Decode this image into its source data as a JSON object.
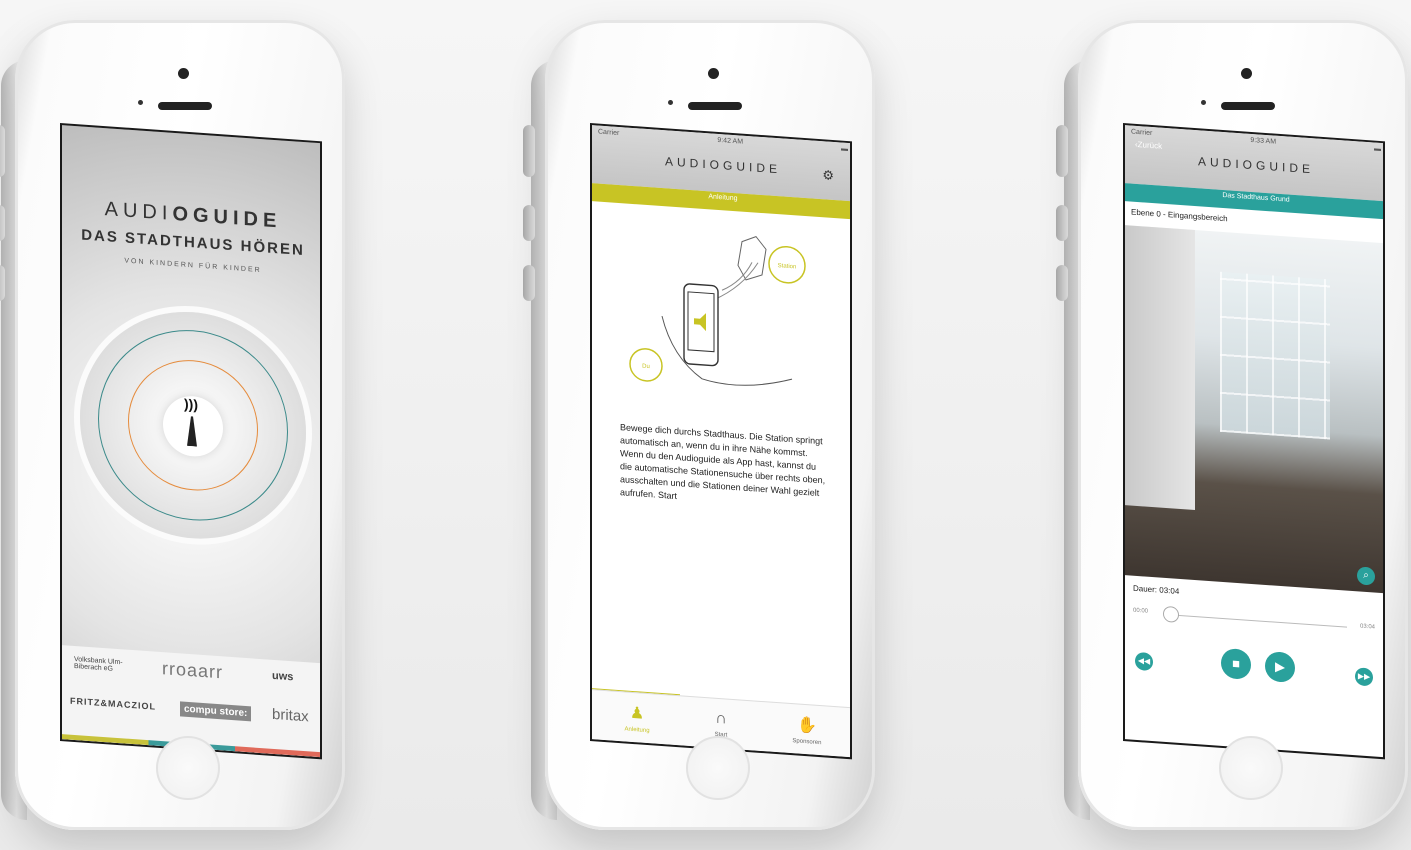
{
  "phone1": {
    "title_a": "AUDI",
    "title_b": "OGUIDE",
    "subtitle": "DAS STADTHAUS HÖREN",
    "tagline": "VON KINDERN FÜR KINDER",
    "sponsors": {
      "s1": "Volksbank Ulm-Biberach eG",
      "s2": "rroaarr",
      "s3": "uws",
      "s4": "FRITZ&MACZIOL",
      "s5": "compu store:",
      "s6": "britax"
    }
  },
  "phone2": {
    "carrier": "Carrier",
    "time": "9:42 AM",
    "logo": "AUDIOGUIDE",
    "tab_label": "Anleitung",
    "station_label": "Station",
    "you_label": "Du",
    "instructions": "Bewege dich durchs Stadthaus. Die Station springt automatisch an, wenn du in ihre Nähe kommst. Wenn du den Audioguide als App hast, kannst du die automatische Stationensuche über rechts oben, ausschalten und die Stationen deiner Wahl gezielt aufrufen. Start",
    "tabs": [
      {
        "label": "Anleitung"
      },
      {
        "label": "Start"
      },
      {
        "label": "Sponsoren"
      }
    ]
  },
  "phone3": {
    "carrier": "Carrier",
    "time": "9:33 AM",
    "back": "Zurück",
    "logo": "AUDIOGUIDE",
    "tab_label": "Das Stadthaus Grund",
    "location": "Ebene 0 - Eingangsbereich",
    "duration_label": "Dauer:",
    "duration_value": "03:04",
    "time_start": "00:00",
    "time_end": "03:04"
  },
  "colors": {
    "accent_yellow": "#c8c424",
    "accent_teal": "#2aa19c",
    "ring_orange": "#e58b3c"
  }
}
